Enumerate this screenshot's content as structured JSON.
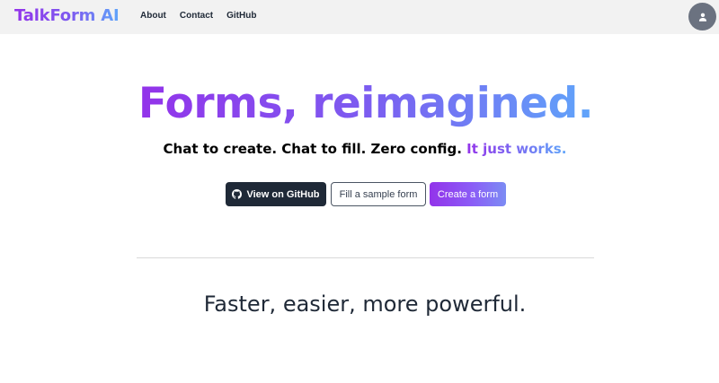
{
  "navbar": {
    "brand": "TalkForm AI",
    "links": [
      "About",
      "Contact",
      "GitHub"
    ],
    "avatar_icon": "user-icon"
  },
  "hero": {
    "title": "Forms, reimagined.",
    "tagline_main": "Chat to create. Chat to fill. Zero config. ",
    "tagline_accent": "It just works."
  },
  "actions": {
    "github_label": "View on GitHub",
    "github_icon": "github-icon",
    "sample_label": "Fill a sample form",
    "create_label": "Create a form"
  },
  "features": {
    "heading": "Faster, easier, more powerful."
  },
  "colors": {
    "gradient_start": "#9333ea",
    "gradient_end": "#60a5fa",
    "dark_button": "#1f2937",
    "nav_background": "#f2f2f2",
    "avatar_background": "#6b7280"
  }
}
